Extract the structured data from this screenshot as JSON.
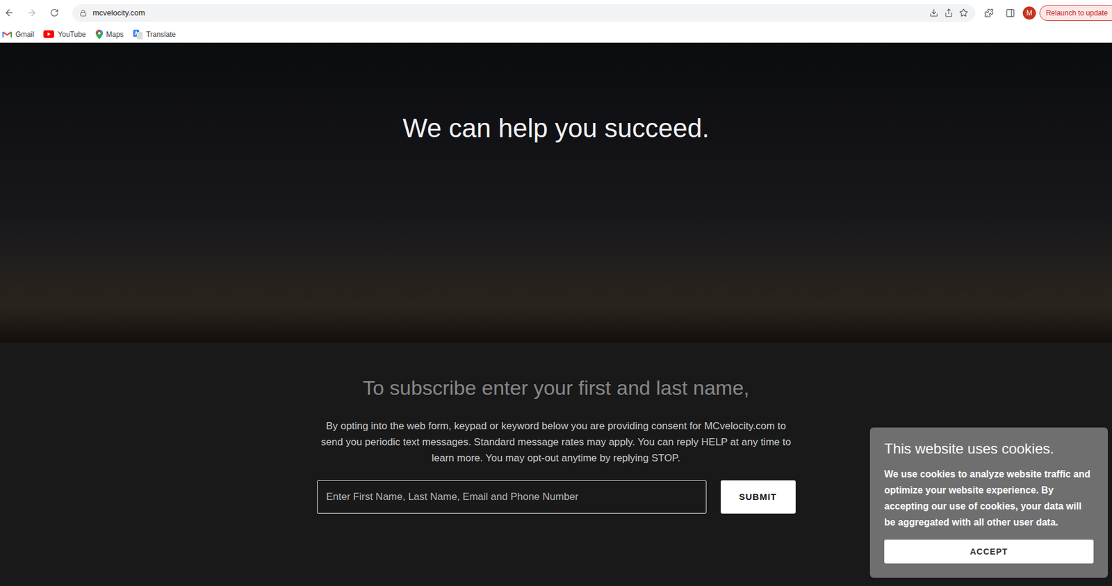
{
  "browser": {
    "url": "mcvelocity.com",
    "profile_initial": "M",
    "update_button": "Relaunch to update"
  },
  "bookmarks": [
    {
      "label": "Gmail",
      "kind": "gmail"
    },
    {
      "label": "YouTube",
      "kind": "youtube"
    },
    {
      "label": "Maps",
      "kind": "maps"
    },
    {
      "label": "Translate",
      "kind": "translate"
    }
  ],
  "hero": {
    "heading": "We can help you succeed."
  },
  "subscribe": {
    "heading": "To subscribe enter your first and last name,",
    "consent": "By opting into the web form, keypad or keyword below you are providing consent for MCvelocity.com to send you periodic text messages. Standard message rates may apply. You can reply HELP at any time to learn more. You may opt-out anytime by replying STOP.",
    "input_placeholder": "Enter First Name, Last Name, Email and Phone Number",
    "button": "SUBMIT"
  },
  "cookie_banner": {
    "title": "This website uses cookies.",
    "body": "We use cookies to analyze website traffic and optimize your website experience. By accepting our use of cookies, your data will be aggregated with all other user data.",
    "button": "ACCEPT"
  }
}
